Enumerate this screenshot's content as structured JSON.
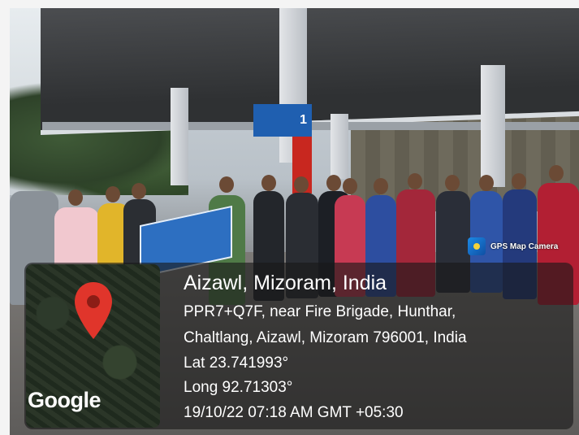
{
  "location": {
    "title": "Aizawl, Mizoram, India",
    "address_line1": "PPR7+Q7F, near Fire Brigade, Hunthar,",
    "address_line2": "Chaltlang, Aizawl, Mizoram 796001, India",
    "latitude": "Lat 23.741993°",
    "longitude": "Long 92.71303°",
    "timestamp": "19/10/22 07:18 AM GMT +05:30"
  },
  "map": {
    "provider_logo": "Google",
    "pin_icon": "map-pin-icon",
    "pin_color": "#e0352b"
  },
  "watermark": {
    "app_name": "GPS Map Camera",
    "icon": "gps-camera-icon"
  },
  "scene": {
    "pump_number": "1"
  }
}
